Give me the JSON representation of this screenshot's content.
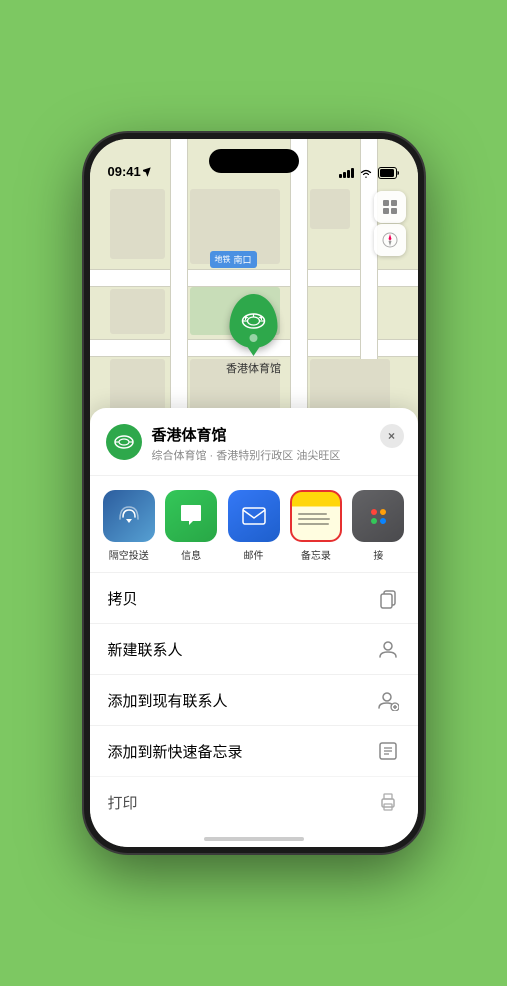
{
  "status_bar": {
    "time": "09:41",
    "location_arrow": "▶"
  },
  "map": {
    "label_text": "南口",
    "marker_label": "香港体育馆"
  },
  "place_card": {
    "name": "香港体育馆",
    "description": "综合体育馆 · 香港特别行政区 油尖旺区",
    "close_label": "×"
  },
  "share_apps": [
    {
      "id": "airdrop",
      "label": "隔空投送"
    },
    {
      "id": "messages",
      "label": "信息"
    },
    {
      "id": "mail",
      "label": "邮件"
    },
    {
      "id": "notes",
      "label": "备忘录"
    },
    {
      "id": "more",
      "label": "接"
    }
  ],
  "actions": [
    {
      "label": "拷贝",
      "icon": "copy"
    },
    {
      "label": "新建联系人",
      "icon": "person"
    },
    {
      "label": "添加到现有联系人",
      "icon": "person-add"
    },
    {
      "label": "添加到新快速备忘录",
      "icon": "note"
    },
    {
      "label": "打印",
      "icon": "printer"
    }
  ],
  "colors": {
    "green_accent": "#2ea84b",
    "blue_accent": "#3478f6",
    "notes_yellow": "#ffd60a",
    "notes_border": "#e63030"
  }
}
